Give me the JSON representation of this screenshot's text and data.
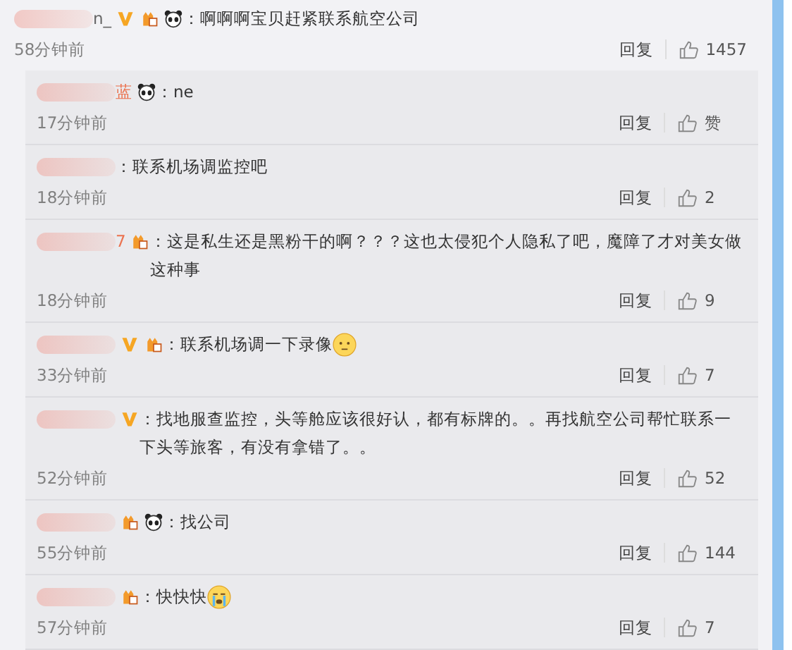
{
  "comments": [
    {
      "name": "n_",
      "badges": [
        {
          "kind": "v"
        },
        {
          "kind": "medal"
        },
        {
          "kind": "panda"
        }
      ],
      "text": "：啊啊啊宝贝赶紧联系航空公司",
      "time": "58分钟前",
      "reply": "回复",
      "likes": "1457",
      "children": [
        {
          "name": "蓝",
          "badges": [
            {
              "kind": "panda"
            }
          ],
          "text": "：ne",
          "time": "17分钟前",
          "reply": "回复",
          "likes": "赞"
        },
        {
          "text": "：联系机场调监控吧",
          "time": "18分钟前",
          "reply": "回复",
          "likes": "2"
        },
        {
          "name": "7",
          "badges": [
            {
              "kind": "medal"
            }
          ],
          "text": "：这是私生还是黑粉干的啊？？？这也太侵犯个人隐私了吧，魔障了才对美女做这种事",
          "time": "18分钟前",
          "reply": "回复",
          "likes": "9"
        },
        {
          "badges": [
            {
              "kind": "v"
            },
            {
              "kind": "medal"
            }
          ],
          "text": "：联系机场调一下录像",
          "emoji": {
            "kind": "smile"
          },
          "time": "33分钟前",
          "reply": "回复",
          "likes": "7"
        },
        {
          "badges": [
            {
              "kind": "v"
            }
          ],
          "text": "：找地服查监控，头等舱应该很好认，都有标牌的。。再找航空公司帮忙联系一下头等旅客，有没有拿错了。。",
          "time": "52分钟前",
          "reply": "回复",
          "likes": "52"
        },
        {
          "badges": [
            {
              "kind": "medal"
            },
            {
              "kind": "panda"
            }
          ],
          "text": "：找公司",
          "time": "55分钟前",
          "reply": "回复",
          "likes": "144"
        },
        {
          "badges": [
            {
              "kind": "medal"
            }
          ],
          "text": "：快快快",
          "emoji": {
            "kind": "cry"
          },
          "time": "57分钟前",
          "reply": "回复",
          "likes": "7"
        }
      ]
    }
  ]
}
